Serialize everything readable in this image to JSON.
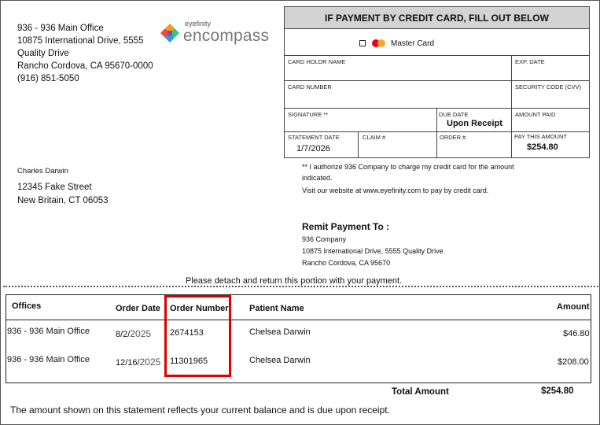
{
  "sender": {
    "line1": "936 - 936 Main Office",
    "line2": "10875 International Drive, 5555",
    "line3": "Quality Drive",
    "line4": "Rancho Cordova, CA 95670-0000",
    "phone": "(916) 851-5050"
  },
  "logo": {
    "small": "eyefinity",
    "big": "encompass",
    "icon": "eyefinity-logo-icon"
  },
  "recipient": {
    "name": "Charles Darwin",
    "street": "12345 Fake Street",
    "city": "New Britain, CT  06053"
  },
  "credit_card": {
    "header": "IF PAYMENT BY CREDIT CARD, FILL OUT BELOW",
    "card_type": "Master Card",
    "card_holder_label": "CARD HOLDR NAME",
    "exp_date_label": "EXP. DATE",
    "card_number_label": "CARD NUMBER",
    "security_code_label": "SECURITY CODE (CVV)",
    "signature_label": "SIGNATURE **",
    "due_date_label": "DUE DATE",
    "due_date_value": "Upon Receipt",
    "amount_paid_label": "AMOUNT PAID",
    "statement_date_label": "STATEMENT DATE",
    "statement_date_value": "1/7/2026",
    "claim_label": "CLAIM #",
    "order_label": "ORDER #",
    "pay_this_amount_label": "PAY THIS AMOUNT",
    "pay_this_amount_value": "$254.80"
  },
  "authorization": {
    "line1": "** I authorize 936 Company to charge my credit card for the amount",
    "line2": "indicated.",
    "website": "Visit our website at www.eyefinity.com to pay by credit card."
  },
  "remit": {
    "title": "Remit Payment To :",
    "company": "936 Company",
    "address": "10875 International Drive, 5555 Quality Drive",
    "city": "Rancho Cordova, CA 95670"
  },
  "detach_note": "Please detach and return this portion with your payment.",
  "table": {
    "headers": {
      "offices": "Offices",
      "order_date": "Order Date",
      "order_number": "Order Number",
      "patient_name": "Patient Name",
      "amount": "Amount"
    },
    "rows": [
      {
        "office": "936 - 936 Main Office",
        "date_a": "8/2/",
        "date_b": "2025",
        "order_number": "2674153",
        "patient": "Chelsea Darwin",
        "amount": "$46.80"
      },
      {
        "office": "936 - 936 Main Office",
        "date_a": "12/16/",
        "date_b": "2025",
        "order_number": "11301965",
        "patient": "Chelsea Darwin",
        "amount": "$208.00"
      }
    ]
  },
  "total": {
    "label": "Total Amount",
    "value": "$254.80"
  },
  "footer_note": "The amount shown on this statement reflects your current balance and is due upon receipt.",
  "colors": {
    "highlight": "#dd0000",
    "header_bg": "#d3d3d3"
  }
}
